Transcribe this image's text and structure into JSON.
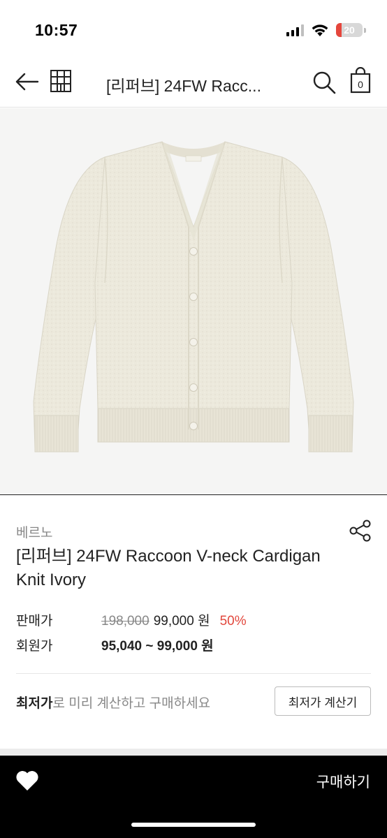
{
  "status_bar": {
    "time": "10:57",
    "battery": "20",
    "battery_level": 0.2,
    "icons": [
      "cellular-signal-icon",
      "wifi-icon",
      "battery-icon"
    ]
  },
  "nav": {
    "title": "[리퍼브] 24FW Racc...",
    "icons": [
      "back-arrow-icon",
      "home-shop-icon",
      "search-icon",
      "shopping-bag-icon"
    ],
    "cart_count": "0"
  },
  "product": {
    "image_alt": "ivory v-neck cardigan knit",
    "brand": "베르노",
    "title": "[리퍼브] 24FW Raccoon V-neck Cardigan Knit Ivory",
    "colors": {
      "knit": "#ece9dc",
      "background": "#f5f5f4"
    }
  },
  "pricing": {
    "sale_label": "판매가",
    "original_price": "198,000",
    "sale_price": "99,000 원",
    "discount": "50%",
    "member_label": "회원가",
    "member_price": "95,040 ~ 99,000 원"
  },
  "calculator": {
    "text_bold": "최저가",
    "text_rest": "로 미리 계산하고 구매하세요",
    "button_label": "최저가 계산기"
  },
  "bottom_bar": {
    "buy_label": "구매하기",
    "icons": [
      "heart-icon"
    ]
  },
  "colors": {
    "accent_red": "#e2483d",
    "bottom_bar": "#000000"
  }
}
